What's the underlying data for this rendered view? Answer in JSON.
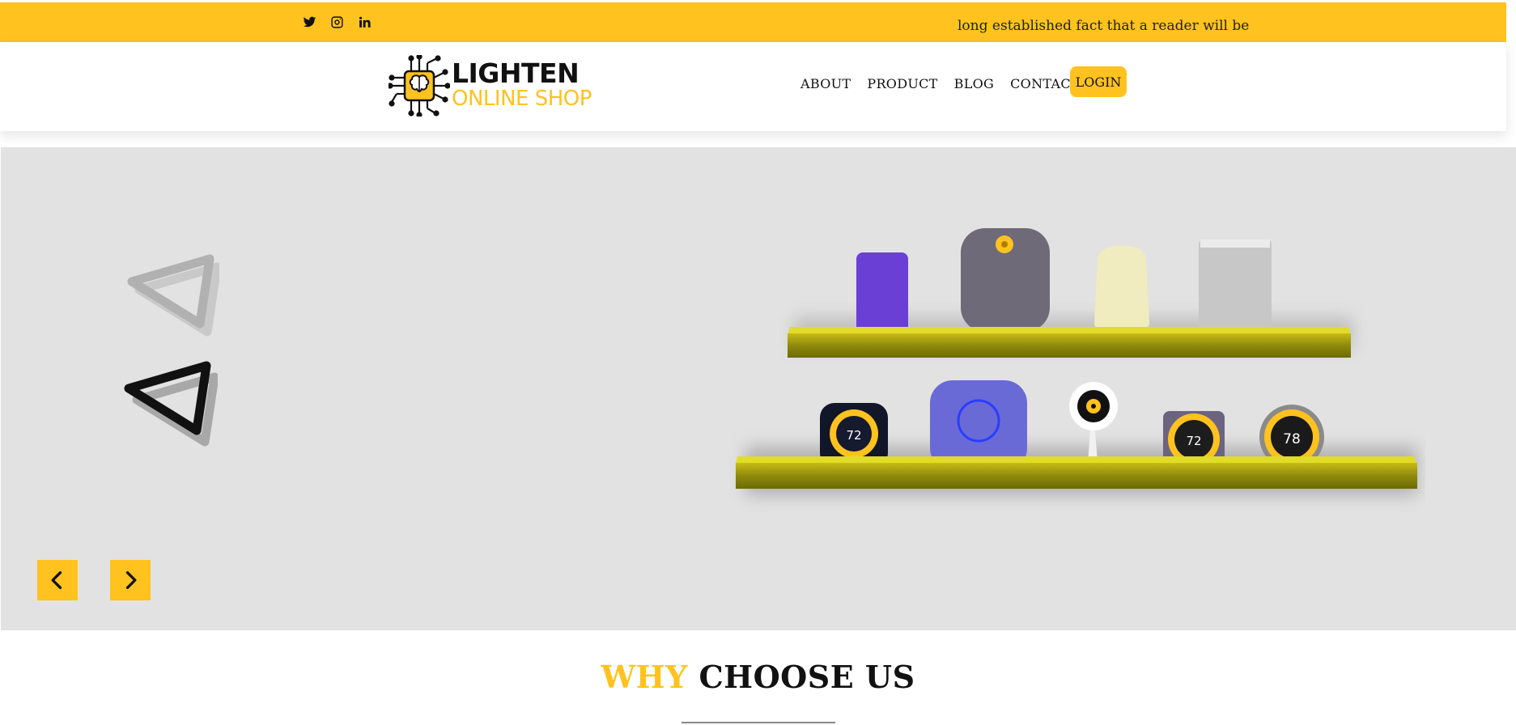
{
  "topbar": {
    "social": [
      {
        "name": "twitter-icon"
      },
      {
        "name": "instagram-icon"
      },
      {
        "name": "linkedin-icon"
      }
    ],
    "ticker_text": "long established fact that a reader will be",
    "background": "#ffc21f"
  },
  "header": {
    "logo": {
      "line1": "LIGHTEN",
      "line2": "ONLINE SHOP",
      "icon": "chip-brain-icon"
    },
    "nav": {
      "about": "ABOUT",
      "product": "PRODUCT",
      "blog": "BLOG",
      "contact": "CONTACT"
    },
    "login_label": "LOGIN"
  },
  "hero": {
    "background": "#e2e2e2",
    "prev_icon": "chevron-left-icon",
    "next_icon": "chevron-right-icon",
    "devices": {
      "thermostat_1": "72",
      "thermostat_2": "72",
      "thermostat_3": "78"
    }
  },
  "section": {
    "title_accent": "WHY",
    "title_rest": "CHOOSE US"
  },
  "colors": {
    "accent": "#ffc21f",
    "dark": "#111111"
  }
}
